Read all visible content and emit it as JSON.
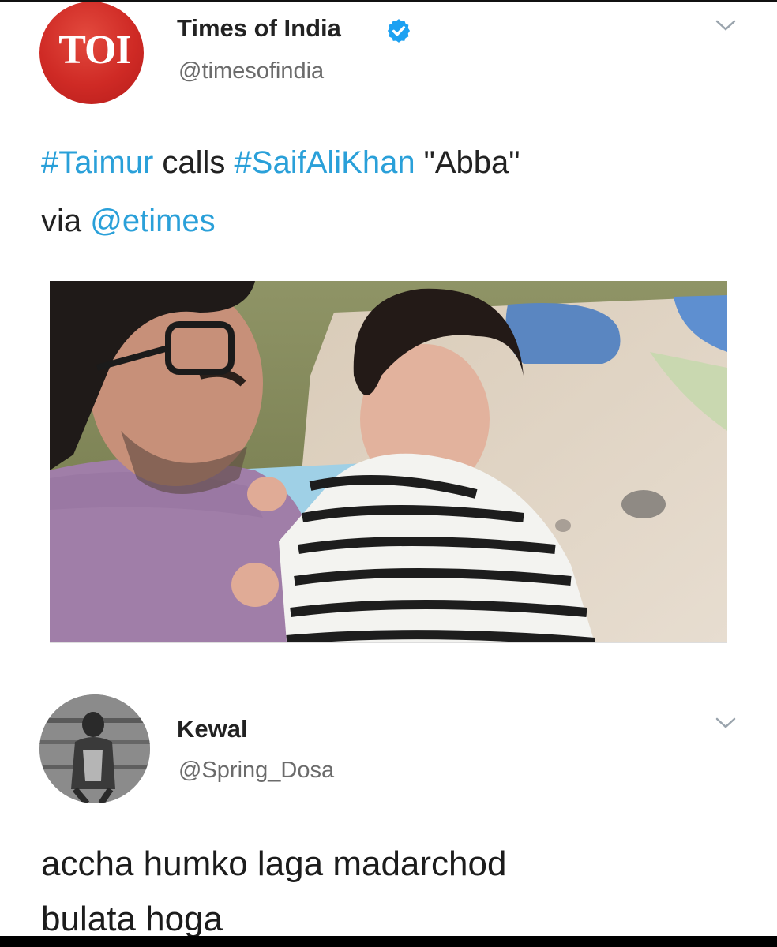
{
  "tweet1": {
    "avatar_text": "TOI",
    "name": "Times of India",
    "handle": "@timesofindia",
    "text_parts": [
      "#Taimur",
      " calls ",
      "#SaifAliKhan",
      " \"Abba\""
    ],
    "line2_parts": [
      "via ",
      "@etimes"
    ]
  },
  "tweet2": {
    "name": "Kewal",
    "handle": "@Spring_Dosa",
    "line1": "accha humko laga madarchod",
    "line2": "bulata hoga"
  },
  "colors": {
    "link": "#2aa0d9",
    "toi_red": "#cf2a25",
    "verified": "#1da1f2"
  },
  "icons": [
    "verified-badge-icon",
    "chevron-down-icon"
  ]
}
